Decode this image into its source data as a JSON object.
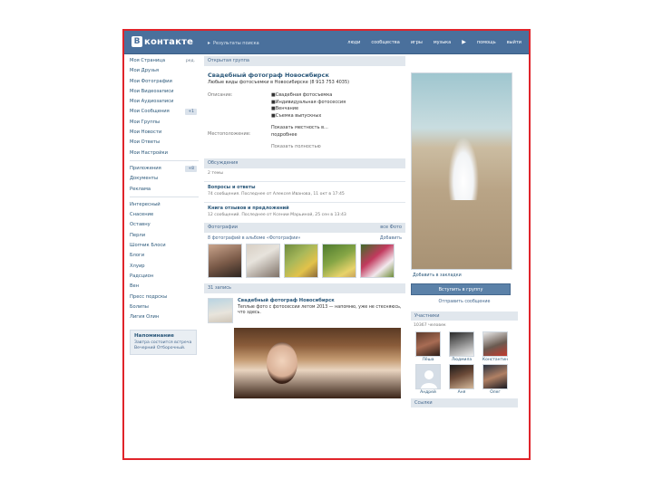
{
  "header": {
    "logo_letter": "B",
    "logo_text": "контакте",
    "search_text": "Результаты поиска",
    "nav": [
      "люди",
      "сообщества",
      "игры",
      "музыка",
      "помощь",
      "выйти"
    ]
  },
  "sidebar": {
    "items": [
      {
        "label": "Моя Страница",
        "edit": "ред."
      },
      {
        "label": "Мои Друзья"
      },
      {
        "label": "Мои Фотографии"
      },
      {
        "label": "Мои Видеозаписи"
      },
      {
        "label": "Мои Аудиозаписи"
      },
      {
        "label": "Мои Сообщения",
        "badge": "+1"
      },
      {
        "label": "Мои Группы"
      },
      {
        "label": "Мои Новости"
      },
      {
        "label": "Мои Ответы"
      },
      {
        "label": "Мои Настройки"
      }
    ],
    "apps": [
      {
        "label": "Приложения",
        "badge": "+8"
      },
      {
        "label": "Документы"
      },
      {
        "label": "Реклама"
      }
    ],
    "extra": [
      "Интересный",
      "Снасение",
      "Оставну",
      "Перли",
      "Шопчик Блоси",
      "Блоги",
      "Хлуир",
      "Радсцион",
      "Вен",
      "Пресс подрскы",
      "Болипы",
      "Лигия Олин"
    ],
    "reminder": {
      "title": "Напоминание",
      "text": "Завтра состоится встреча Вечерний Отборочный."
    }
  },
  "center": {
    "section_title": "Открытая группа",
    "group_name": "Свадебный фотограф Новосибирск",
    "group_desc": "Любые виды фотосъемки в Новосибирске (8 913 753 4035)",
    "info": [
      {
        "label": "Описание:",
        "lines": [
          "■Свадебная фотосъемка",
          "■Индивидуальная фотосессия",
          "■Венчание",
          "■Съемка выпускных"
        ]
      },
      {
        "label": "Местоположение:",
        "lines": [
          "Показать местность в...",
          "подробнее"
        ]
      }
    ],
    "info_more": "Показать полностью",
    "events_head": "Обсуждения",
    "events_sub": "2 темы",
    "discussions": [
      {
        "title": "Вопросы и ответы",
        "meta": "74 сообщения. Последнее от Алексея Иванова, 11 окт в 17:45"
      },
      {
        "title": "Книга отзывов и предложений",
        "meta": "12 сообщений. Последнее от Ксении Марьиной, 25 сен в 13:43"
      }
    ],
    "photos_head": "Фотографии",
    "photos_all": "все Фото",
    "photos_count": "8 фотографий в альбоме «Фотографии»",
    "photos_add": "Добавить",
    "wall_head": "31 запись",
    "wall": {
      "author": "Свадебный фотограф Новосибирск",
      "text": "Теплые фото с фотосессии летом 2013 — напомню, уже не стесняюсь, что здесь."
    }
  },
  "right": {
    "add_to_bookmarks": "Добавить в закладки",
    "join": "Вступить в группу",
    "contact": "Отправить сообщение",
    "members_head": "Участники",
    "members_count": "10367 человек",
    "members": [
      "Лёша",
      "Людмила",
      "Константин",
      "Андрей",
      "Аня",
      "Олег"
    ],
    "contacts_head": "Ссылки"
  }
}
